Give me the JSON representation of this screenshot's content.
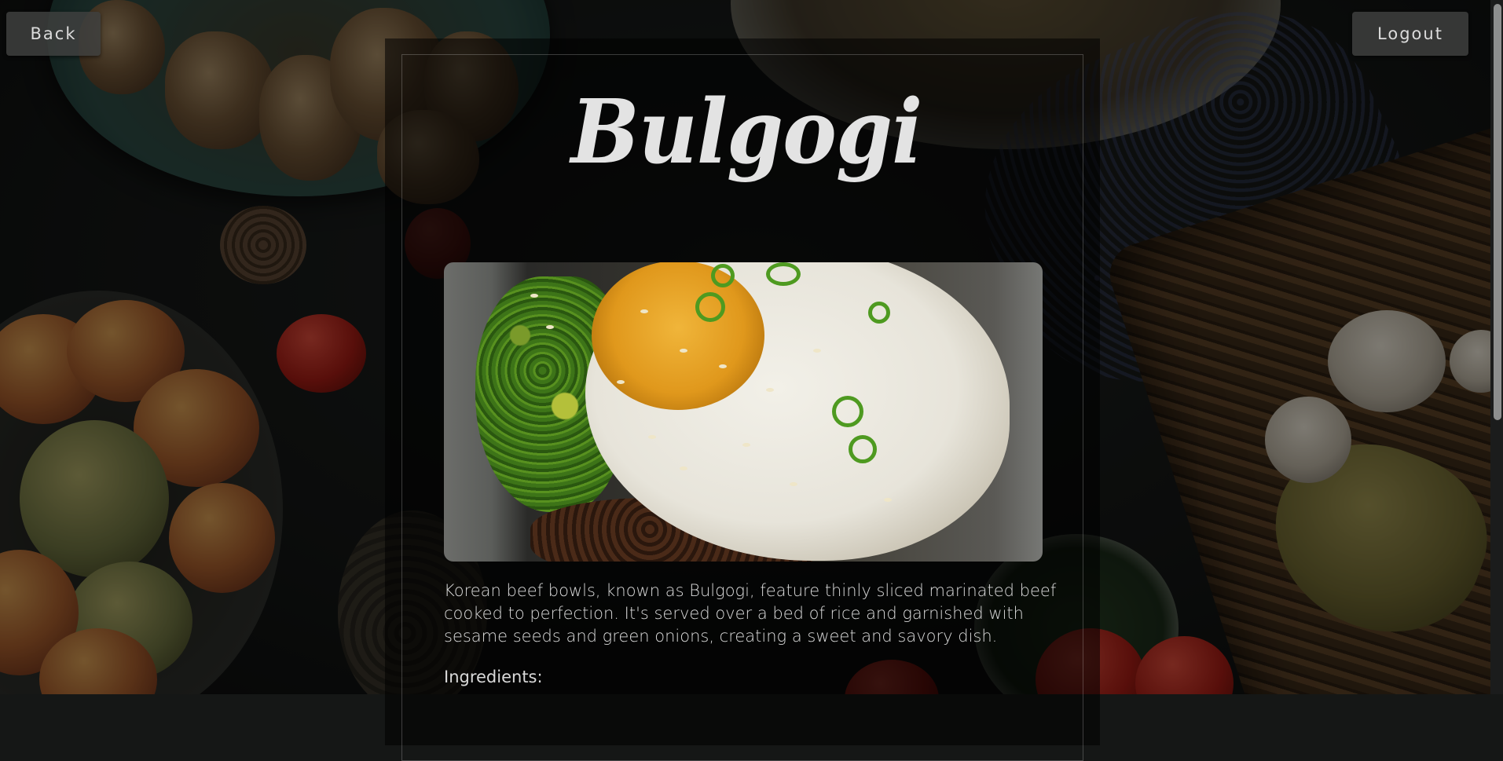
{
  "nav": {
    "back_label": "Back",
    "logout_label": "Logout"
  },
  "recipe": {
    "title": "Bulgogi",
    "image_alt": "Bulgogi bowl with fried egg, broccoli and green onions",
    "description": "Korean beef bowls, known as Bulgogi, feature thinly sliced marinated beef cooked to perfection. It's served over a bed of rice and garnished with sesame seeds and green onions, creating a sweet and savory dish.",
    "ingredients_label": "Ingredients:"
  },
  "colors": {
    "panel_background": "#000000",
    "text": "#d9d9d9",
    "button_background": "#3e3f3e"
  }
}
